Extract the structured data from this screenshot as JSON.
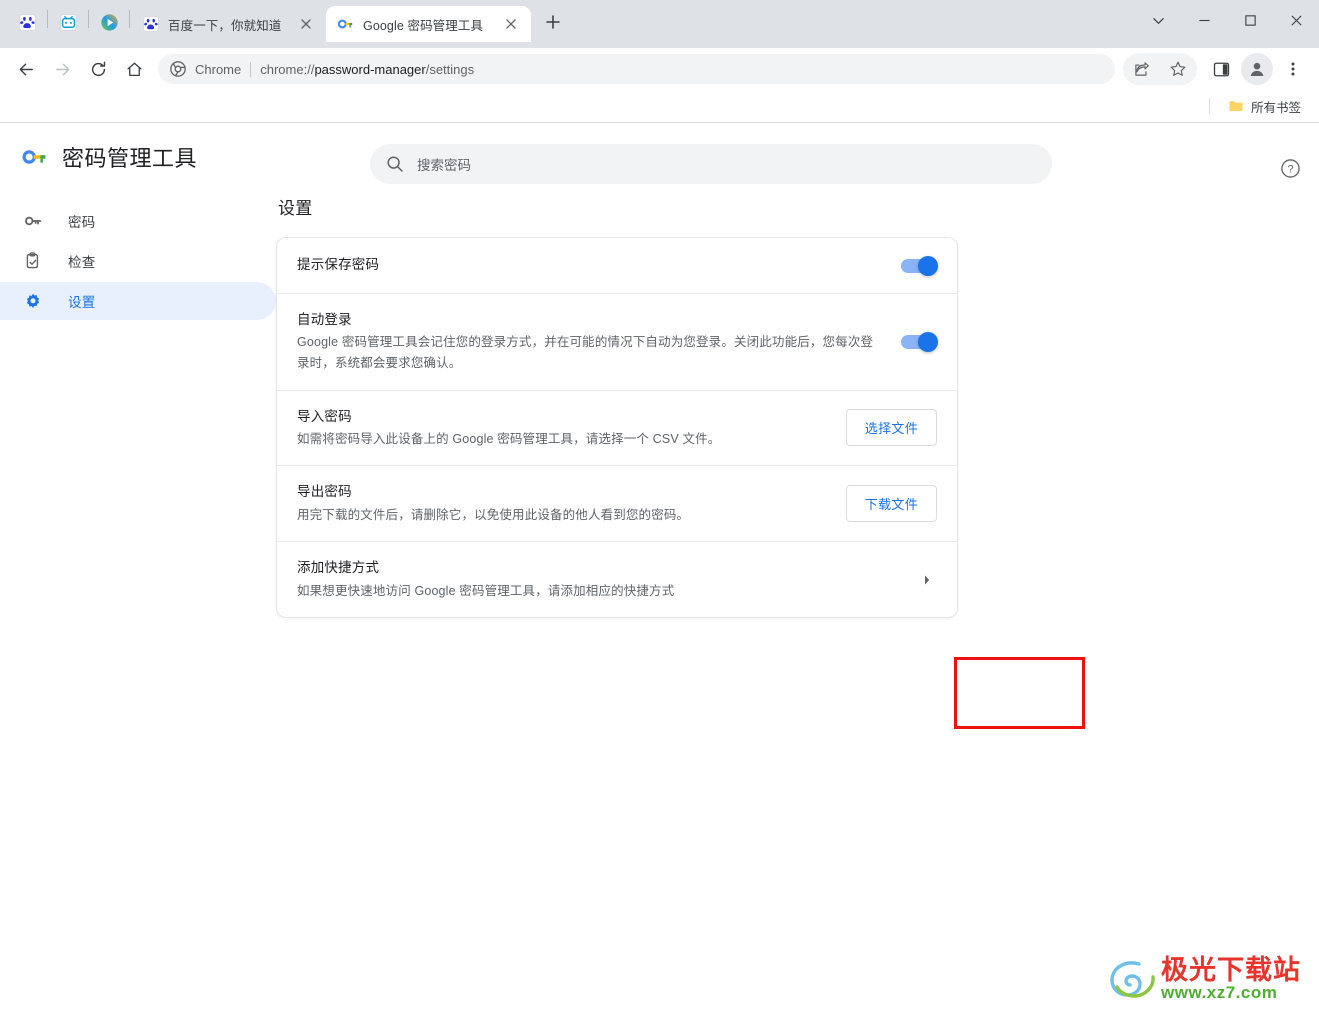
{
  "window": {
    "controls": [
      {
        "name": "tab-search",
        "icon": "chevron-down-icon"
      },
      {
        "name": "minimize",
        "icon": "minimize-icon"
      },
      {
        "name": "maximize",
        "icon": "maximize-icon"
      },
      {
        "name": "close",
        "icon": "close-icon"
      }
    ]
  },
  "tabstrip": {
    "pinned": [
      {
        "name": "baidu-pinned-tab",
        "icon": "baidu-paw-icon"
      },
      {
        "name": "bilibili-pinned-tab",
        "icon": "bilibili-tv-icon"
      },
      {
        "name": "video-pinned-tab",
        "icon": "play-circle-icon"
      }
    ],
    "tabs": [
      {
        "title": "百度一下，你就知道",
        "favicon": "baidu-paw-icon",
        "active": false
      },
      {
        "title": "Google 密码管理工具",
        "favicon": "google-password-key-icon",
        "active": true
      }
    ],
    "new_tab_label": "+"
  },
  "toolbar": {
    "back_icon": "arrow-left-icon",
    "forward_icon": "arrow-right-icon",
    "reload_icon": "reload-icon",
    "home_icon": "home-icon",
    "omnibox": {
      "site_icon": "chrome-logo-icon",
      "site_label": "Chrome",
      "url_prefix": "chrome://",
      "url_bold": "password-manager",
      "url_suffix": "/settings",
      "full_url": "chrome://password-manager/settings"
    },
    "share_icon": "share-icon",
    "bookmark_icon": "star-icon",
    "side_panel_icon": "side-panel-icon",
    "profile_icon": "profile-avatar-icon",
    "menu_icon": "three-dot-menu-icon"
  },
  "bookmarkbar": {
    "all_bookmarks_label": "所有书签",
    "folder_icon": "folder-icon"
  },
  "password_manager": {
    "brand_title": "密码管理工具",
    "brand_icon": "google-password-key-icon",
    "search_placeholder": "搜索密码",
    "search_icon": "search-icon",
    "help_icon": "help-circle-icon",
    "nav": [
      {
        "label": "密码",
        "icon": "key-icon",
        "active": false
      },
      {
        "label": "检查",
        "icon": "checkup-clipboard-icon",
        "active": false
      },
      {
        "label": "设置",
        "icon": "gear-icon",
        "active": true
      }
    ],
    "section_title": "设置",
    "rows": [
      {
        "title": "提示保存密码",
        "sub": "",
        "control": "toggle",
        "toggle_on": true
      },
      {
        "title": "自动登录",
        "sub": "Google 密码管理工具会记住您的登录方式，并在可能的情况下自动为您登录。关闭此功能后，您每次登录时，系统都会要求您确认。",
        "control": "toggle",
        "toggle_on": true
      },
      {
        "title": "导入密码",
        "sub": "如需将密码导入此设备上的 Google 密码管理工具，请选择一个 CSV 文件。",
        "control": "button",
        "button_label": "选择文件"
      },
      {
        "title": "导出密码",
        "sub": "用完下载的文件后，请删除它，以免使用此设备的他人看到您的密码。",
        "control": "button",
        "button_label": "下载文件",
        "highlighted": true
      },
      {
        "title": "添加快捷方式",
        "sub": "如果想更快速地访问 Google 密码管理工具，请添加相应的快捷方式",
        "control": "chevron",
        "chevron_icon": "chevron-right-icon"
      }
    ]
  },
  "annotation": {
    "color": "#ee1111",
    "target": "下载文件"
  },
  "watermark": {
    "cn": "极光下载站",
    "en": "www.xz7.com",
    "logo_icon": "aurora-swirl-logo-icon"
  },
  "colors": {
    "accent": "#1a73e8",
    "toggle_track": "#8ab4f8",
    "nav_active_bg": "#e8f0fe",
    "tabstrip_bg": "#dee1e6",
    "omnibox_bg": "#f1f3f4",
    "annotation_red": "#ee1111"
  }
}
